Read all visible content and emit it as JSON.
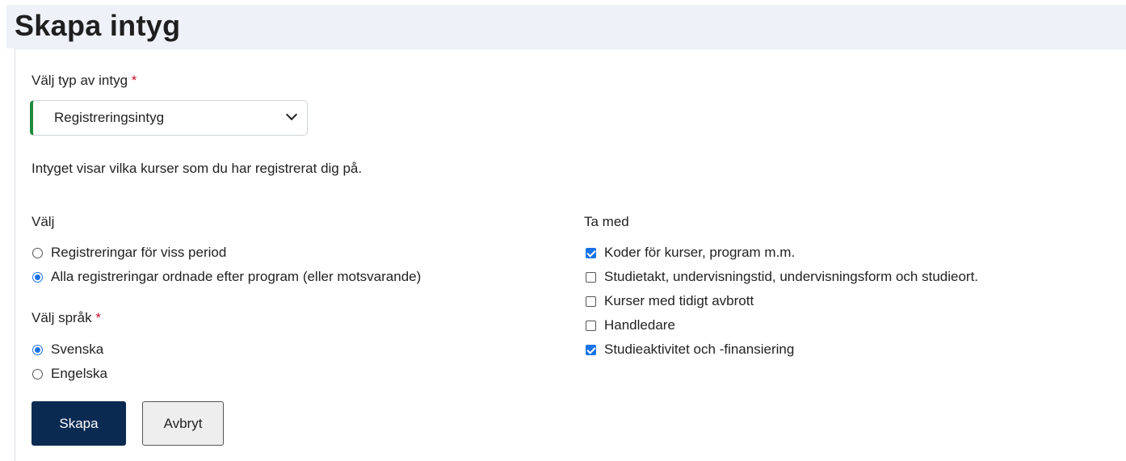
{
  "page": {
    "title": "Skapa intyg"
  },
  "certificate_type": {
    "label": "Välj typ av intyg",
    "required_mark": "*",
    "selected": "Registreringsintyg",
    "description": "Intyget visar vilka kurser som du har registrerat dig på."
  },
  "choose": {
    "label": "Välj",
    "options": [
      {
        "label": "Registreringar för viss period",
        "checked": false
      },
      {
        "label": "Alla registreringar ordnade efter program (eller motsvarande)",
        "checked": true
      }
    ]
  },
  "language": {
    "label": "Välj språk",
    "required_mark": "*",
    "options": [
      {
        "label": "Svenska",
        "checked": true
      },
      {
        "label": "Engelska",
        "checked": false
      }
    ]
  },
  "include": {
    "label": "Ta med",
    "options": [
      {
        "label": "Koder för kurser, program m.m.",
        "checked": true
      },
      {
        "label": "Studietakt, undervisningstid, undervisningsform och studieort.",
        "checked": false
      },
      {
        "label": "Kurser med tidigt avbrott",
        "checked": false
      },
      {
        "label": "Handledare",
        "checked": false
      },
      {
        "label": "Studieaktivitet och -finansiering",
        "checked": true
      }
    ]
  },
  "actions": {
    "create_label": "Skapa",
    "cancel_label": "Avbryt"
  },
  "colors": {
    "primary_button": "#0b2a52",
    "select_accent": "#1f8a3e",
    "required": "#c8102e",
    "control_checked": "#1a73e8"
  }
}
